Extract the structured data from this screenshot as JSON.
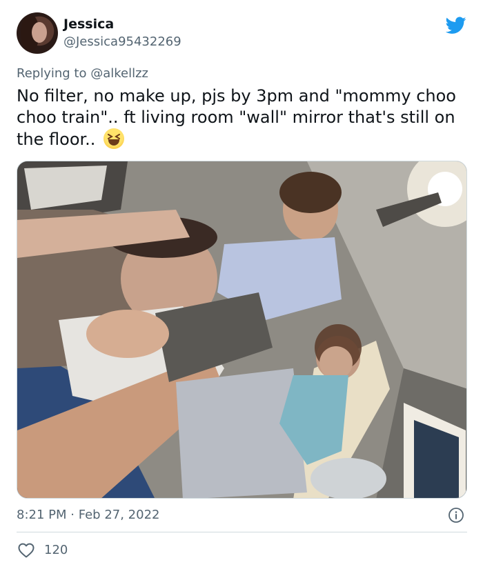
{
  "author": {
    "name": "Jessica",
    "handle": "@Jessica95432269"
  },
  "reply": {
    "prefix": "Replying to",
    "mention": "@alkellzz"
  },
  "tweet": {
    "text": "No filter, no make up, pjs by 3pm and \"mommy choo choo train\".. ft living room \"wall\" mirror that's still on the floor.."
  },
  "meta": {
    "time": "8:21 PM",
    "separator": "·",
    "date": "Feb 27, 2022"
  },
  "stats": {
    "likes": "120"
  },
  "colors": {
    "brand": "#1d9bf0",
    "text": "#0f1419",
    "secondary": "#536471",
    "border": "#cfd9de"
  },
  "icons": {
    "brand": "twitter-bird-icon",
    "info": "info-icon",
    "like": "heart-icon",
    "emoji": "grinning-squinting-face-emoji"
  }
}
